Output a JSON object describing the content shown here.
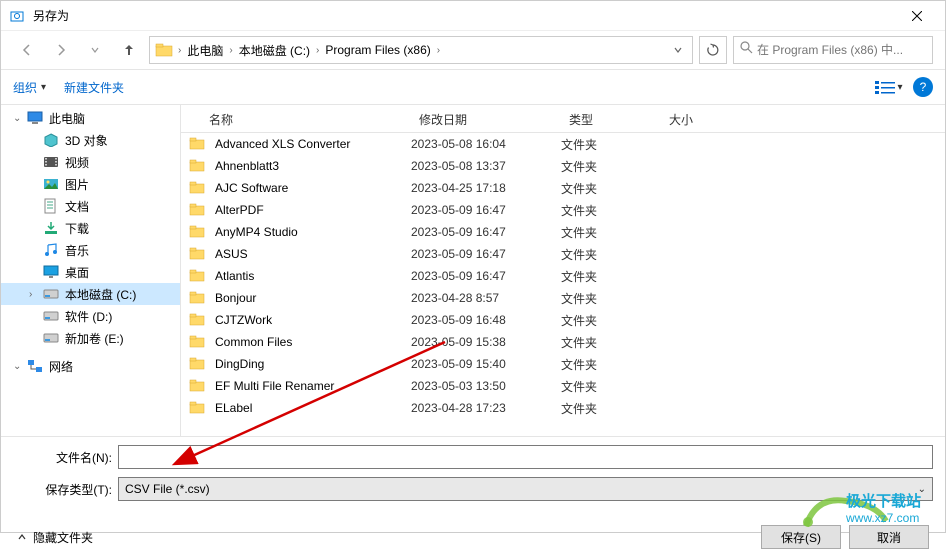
{
  "window": {
    "title": "另存为"
  },
  "breadcrumb": {
    "items": [
      "此电脑",
      "本地磁盘 (C:)",
      "Program Files (x86)"
    ]
  },
  "search": {
    "placeholder": "在 Program Files (x86) 中..."
  },
  "toolbar": {
    "organize": "组织",
    "new_folder": "新建文件夹"
  },
  "sidebar": {
    "items": [
      {
        "label": "此电脑",
        "icon": "pc",
        "indent": 0
      },
      {
        "label": "3D 对象",
        "icon": "3d",
        "indent": 1
      },
      {
        "label": "视频",
        "icon": "video",
        "indent": 1
      },
      {
        "label": "图片",
        "icon": "picture",
        "indent": 1
      },
      {
        "label": "文档",
        "icon": "document",
        "indent": 1
      },
      {
        "label": "下载",
        "icon": "download",
        "indent": 1
      },
      {
        "label": "音乐",
        "icon": "music",
        "indent": 1
      },
      {
        "label": "桌面",
        "icon": "desktop",
        "indent": 1
      },
      {
        "label": "本地磁盘 (C:)",
        "icon": "disk",
        "indent": 1,
        "selected": true
      },
      {
        "label": "软件 (D:)",
        "icon": "disk",
        "indent": 1
      },
      {
        "label": "新加卷 (E:)",
        "icon": "disk",
        "indent": 1
      },
      {
        "label": "",
        "spacer": true
      },
      {
        "label": "网络",
        "icon": "network",
        "indent": 0
      }
    ]
  },
  "columns": {
    "name": "名称",
    "date": "修改日期",
    "type": "类型",
    "size": "大小"
  },
  "files": [
    {
      "name": "Advanced XLS Converter",
      "date": "2023-05-08 16:04",
      "type": "文件夹"
    },
    {
      "name": "Ahnenblatt3",
      "date": "2023-05-08 13:37",
      "type": "文件夹"
    },
    {
      "name": "AJC Software",
      "date": "2023-04-25 17:18",
      "type": "文件夹"
    },
    {
      "name": "AlterPDF",
      "date": "2023-05-09 16:47",
      "type": "文件夹"
    },
    {
      "name": "AnyMP4 Studio",
      "date": "2023-05-09 16:47",
      "type": "文件夹"
    },
    {
      "name": "ASUS",
      "date": "2023-05-09 16:47",
      "type": "文件夹"
    },
    {
      "name": "Atlantis",
      "date": "2023-05-09 16:47",
      "type": "文件夹"
    },
    {
      "name": "Bonjour",
      "date": "2023-04-28 8:57",
      "type": "文件夹"
    },
    {
      "name": "CJTZWork",
      "date": "2023-05-09 16:48",
      "type": "文件夹"
    },
    {
      "name": "Common Files",
      "date": "2023-05-09 15:38",
      "type": "文件夹"
    },
    {
      "name": "DingDing",
      "date": "2023-05-09 15:40",
      "type": "文件夹"
    },
    {
      "name": "EF Multi File Renamer",
      "date": "2023-05-03 13:50",
      "type": "文件夹"
    },
    {
      "name": "ELabel",
      "date": "2023-04-28 17:23",
      "type": "文件夹"
    }
  ],
  "fields": {
    "filename_label": "文件名(N):",
    "filename_value": "",
    "filetype_label": "保存类型(T):",
    "filetype_value": "CSV File (*.csv)"
  },
  "footer": {
    "hide_folders": "隐藏文件夹",
    "save": "保存(S)",
    "cancel": "取消"
  },
  "watermark": {
    "line1": "极光下载站",
    "line2": "www.xz7.com"
  }
}
